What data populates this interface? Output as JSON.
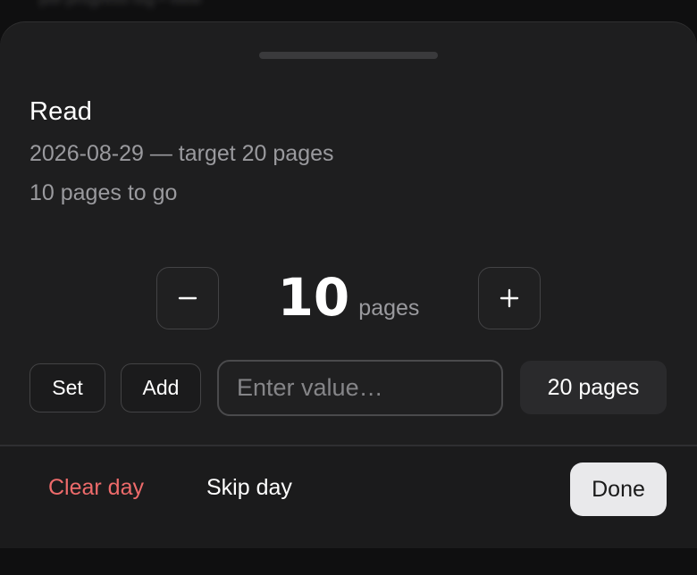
{
  "background": {
    "blurred_text": "pdf progress log • view"
  },
  "sheet": {
    "title": "Read",
    "subtitle": "2026-08-29 — target 20 pages",
    "remaining": "10 pages to go"
  },
  "stepper": {
    "value": "10",
    "unit": "pages",
    "minus_icon": "minus-icon",
    "plus_icon": "plus-icon"
  },
  "actions": {
    "set_label": "Set",
    "add_label": "Add",
    "input_placeholder": "Enter value…",
    "input_value": "",
    "target_label": "20 pages"
  },
  "footer": {
    "clear_label": "Clear day",
    "skip_label": "Skip day",
    "done_label": "Done"
  },
  "colors": {
    "sheet_background": "#1e1e1f",
    "destructive": "#ee6b6b",
    "primary_button": "#e9e9eb"
  }
}
